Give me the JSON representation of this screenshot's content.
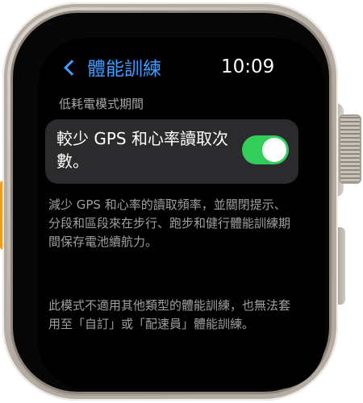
{
  "header": {
    "back_label": "體能訓練",
    "time": "10:09"
  },
  "section": {
    "title": "低耗電模式期間"
  },
  "toggle": {
    "label": "較少 GPS 和心率讀取次數。",
    "state": "on",
    "on_color": "#33cd5a"
  },
  "descriptions": [
    "減少 GPS 和心率的讀取頻率，並關閉提示、分段和區段來在步行、跑步和健行體能訓練期間保存電池續航力。",
    "此模式不適用其他類型的體能訓練，也無法套用至「自訂」或「配速員」體能訓練。"
  ],
  "colors": {
    "accent": "#3f9bff",
    "screen_bg": "#000000",
    "cell_bg": "#2b2b2d",
    "secondary_text": "#9f9f9f",
    "action_button": "#f19a1e"
  }
}
